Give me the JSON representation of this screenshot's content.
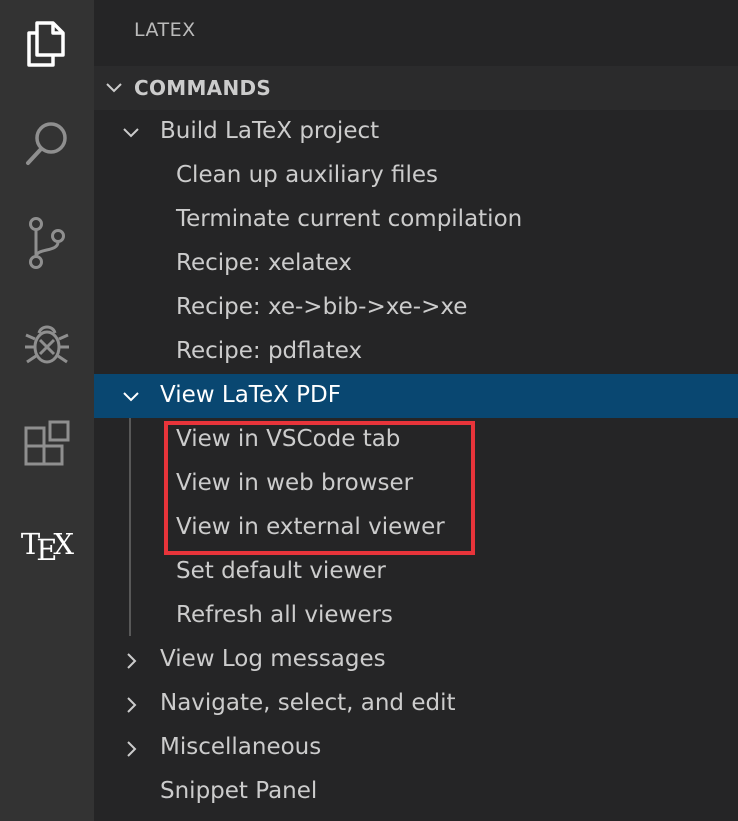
{
  "activity_bar": {
    "icons": [
      "files-icon",
      "search-icon",
      "source-control-icon",
      "debug-icon",
      "extensions-icon",
      "tex-icon"
    ],
    "tex_label": {
      "t": "T",
      "e": "E",
      "x": "X"
    }
  },
  "sidebar": {
    "title": "LATEX",
    "section_title": "COMMANDS",
    "rows": [
      {
        "label": "Build LaTeX project",
        "expanded": true
      },
      {
        "label": "Clean up auxiliary files"
      },
      {
        "label": "Terminate current compilation"
      },
      {
        "label": "Recipe: xelatex"
      },
      {
        "label": "Recipe: xe->bib->xe->xe"
      },
      {
        "label": "Recipe: pdflatex"
      },
      {
        "label": "View LaTeX PDF",
        "expanded": true,
        "selected": true
      },
      {
        "label": "View in VSCode tab"
      },
      {
        "label": "View in web browser"
      },
      {
        "label": "View in external viewer"
      },
      {
        "label": "Set default viewer"
      },
      {
        "label": "Refresh all viewers"
      },
      {
        "label": "View Log messages",
        "expanded": false
      },
      {
        "label": "Navigate, select, and edit",
        "expanded": false
      },
      {
        "label": "Miscellaneous",
        "expanded": false
      },
      {
        "label": "Snippet Panel"
      }
    ]
  },
  "colors": {
    "activity_bar_bg": "#333333",
    "sidebar_bg": "#252526",
    "selection_bg": "#094771",
    "highlight_border": "#e8343a",
    "text": "#cccccc"
  }
}
